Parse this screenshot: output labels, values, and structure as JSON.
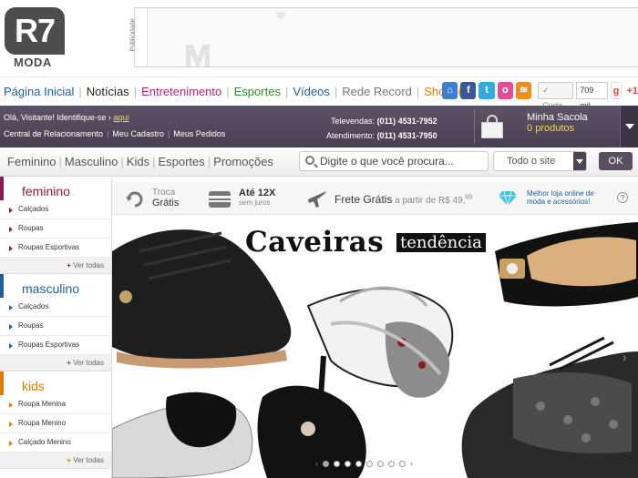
{
  "logo": {
    "main": "R7",
    "sub": "MODA"
  },
  "ad": {
    "label": "Publicidade"
  },
  "mainnav": {
    "items": [
      {
        "label": "Página Inicial",
        "color": "#1f5f9e"
      },
      {
        "label": "Notícias",
        "color": "#222222"
      },
      {
        "label": "Entretenimento",
        "color": "#b0237b"
      },
      {
        "label": "Esportes",
        "color": "#2e8b2e"
      },
      {
        "label": "Vídeos",
        "color": "#1f5f9e"
      },
      {
        "label": "Rede Record",
        "color": "#777777"
      },
      {
        "label": "Shopping",
        "color": "#e07b00"
      }
    ],
    "curtir": "Curtir",
    "like_count": "709 mil",
    "gplus": "+1"
  },
  "account": {
    "greeting": "Olá, Visitante! Identifique-se",
    "login_link": "aqui",
    "links": [
      "Central de Relacionamento",
      "Meu Cadastro",
      "Meus Pedidos"
    ],
    "televendas_label": "Televendas:",
    "televendas": "(011) 4531-7952",
    "atendimento_label": "Atendimento:",
    "atendimento": "(011) 4531-7950",
    "bag_title": "Minha Sacola",
    "bag_count": "0",
    "bag_unit": "produtos"
  },
  "catnav": {
    "categories": [
      "Feminino",
      "Masculino",
      "Kids",
      "Esportes",
      "Promoções"
    ],
    "search_placeholder": "Digite o que você procura...",
    "scope": "Todo o site",
    "ok": "OK"
  },
  "sidebar": {
    "sections": [
      {
        "title": "feminino",
        "color": "#8c1d4a",
        "items": [
          "Calçados",
          "Roupas",
          "Roupas Esportivas"
        ],
        "more": "Ver todas"
      },
      {
        "title": "masculino",
        "color": "#1f5f9e",
        "items": [
          "Calçados",
          "Roupas",
          "Roupas Esportivas"
        ],
        "more": "Ver todas"
      },
      {
        "title": "kids",
        "color": "#e07b00",
        "items": [
          "Roupa Menina",
          "Roupa Menino",
          "Calçado Menino"
        ],
        "more": "Ver todas"
      }
    ]
  },
  "benefits": {
    "troca_1": "Troca",
    "troca_2": "Grátis",
    "parc_1": "Até 12X",
    "parc_2": "sem juros",
    "frete_1": "Frete Grátis",
    "frete_2": "a partir de R$ 49,",
    "frete_cents": "99",
    "loja_1": "Melhor loja online de",
    "loja_2": "moda e acessórios!",
    "help": "?"
  },
  "banner": {
    "headline": "Caveiras",
    "tag": "tendência",
    "slide_count": 8,
    "active_slide": 1
  }
}
